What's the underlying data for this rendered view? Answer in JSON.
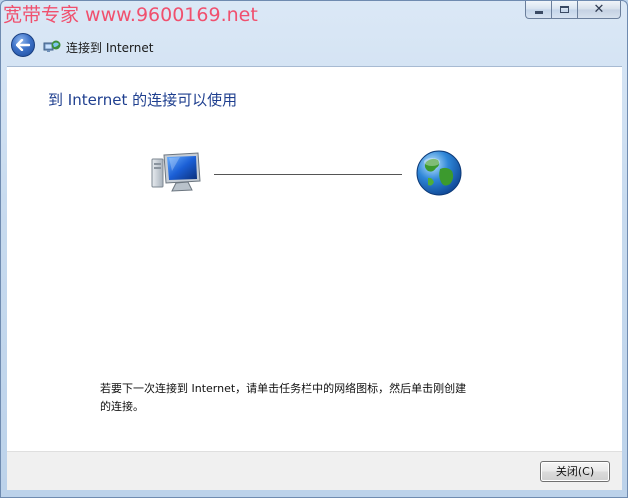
{
  "watermark": "宽带专家 www.9600169.net",
  "titlebar": {
    "minimize_icon": "minimize-icon",
    "maximize_icon": "maximize-icon",
    "close_glyph": "✕"
  },
  "nav": {
    "back_icon": "back-arrow-icon",
    "app_icon": "network-connection-icon",
    "title": "连接到 Internet"
  },
  "main": {
    "heading": "到 Internet 的连接可以使用",
    "diagram": {
      "left_icon": "computer-icon",
      "right_icon": "globe-icon"
    },
    "instructions": "若要下一次连接到 Internet，请单击任务栏中的网络图标，然后单击刚创建的连接。"
  },
  "footer": {
    "close_label": "关闭(C)"
  },
  "colors": {
    "heading": "#1f3f8f",
    "watermark": "#f0506e",
    "frame": "#c8dbef"
  }
}
